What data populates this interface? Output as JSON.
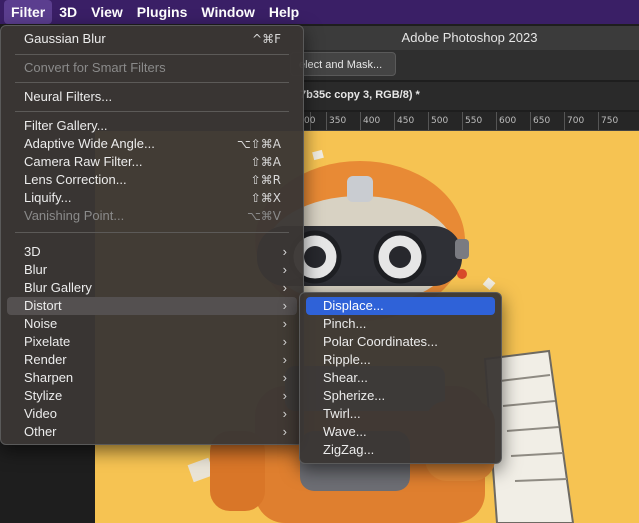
{
  "menubar": {
    "items": [
      "Filter",
      "3D",
      "View",
      "Plugins",
      "Window",
      "Help"
    ]
  },
  "app": {
    "title": "Adobe Photoshop 2023",
    "select_mask": "elect and Mask...",
    "doc_tab": "7b35c copy 3, RGB/8) *",
    "ruler_ticks": [
      "00",
      "350",
      "400",
      "450",
      "500",
      "550",
      "600",
      "650",
      "700",
      "750"
    ]
  },
  "filter_menu": {
    "gaussian_blur": {
      "label": "Gaussian Blur",
      "shortcut": "^⌘F"
    },
    "convert_smart": {
      "label": "Convert for Smart Filters"
    },
    "neural_filters": {
      "label": "Neural Filters..."
    },
    "filter_gallery": {
      "label": "Filter Gallery..."
    },
    "adaptive_wide": {
      "label": "Adaptive Wide Angle...",
      "shortcut": "⌥⇧⌘A"
    },
    "camera_raw": {
      "label": "Camera Raw Filter...",
      "shortcut": "⇧⌘A"
    },
    "lens_correction": {
      "label": "Lens Correction...",
      "shortcut": "⇧⌘R"
    },
    "liquify": {
      "label": "Liquify...",
      "shortcut": "⇧⌘X"
    },
    "vanishing_point": {
      "label": "Vanishing Point...",
      "shortcut": "⌥⌘V"
    },
    "submenus": [
      "3D",
      "Blur",
      "Blur Gallery",
      "Distort",
      "Noise",
      "Pixelate",
      "Render",
      "Sharpen",
      "Stylize",
      "Video",
      "Other"
    ],
    "arrow": "›"
  },
  "distort_menu": {
    "items": [
      "Displace...",
      "Pinch...",
      "Polar Coordinates...",
      "Ripple...",
      "Shear...",
      "Spherize...",
      "Twirl...",
      "Wave...",
      "ZigZag..."
    ]
  }
}
